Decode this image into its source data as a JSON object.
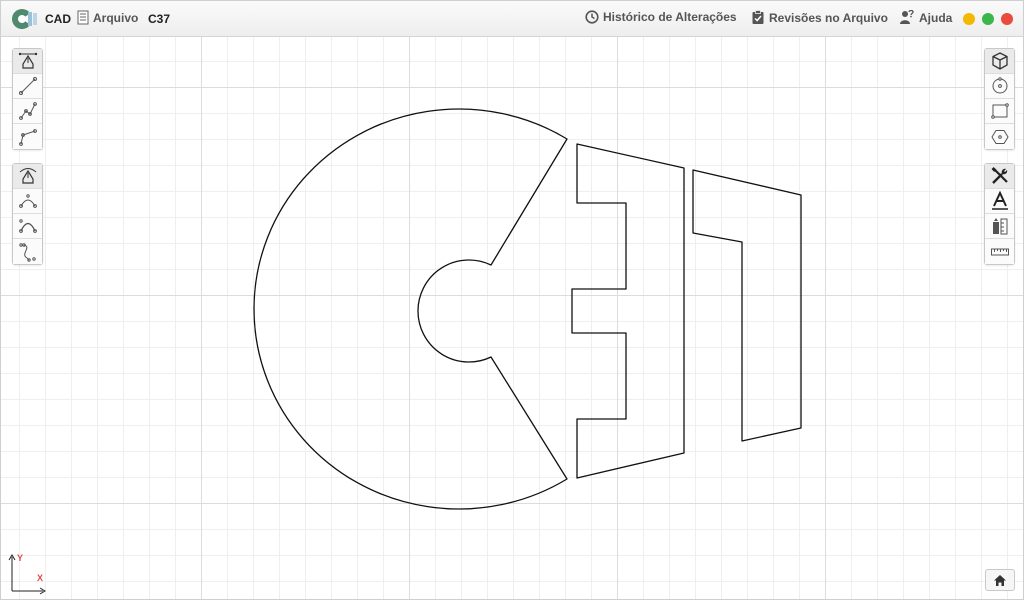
{
  "header": {
    "app_name": "CAD",
    "file_menu_label": "Arquivo",
    "document_name": "C37",
    "history_label": "Histórico de Alterações",
    "revisions_label": "Revisões no Arquivo",
    "help_label": "Ajuda"
  },
  "window_controls": {
    "minimize_color": "#f5b800",
    "maximize_color": "#3cb54a",
    "close_color": "#e94b3c"
  },
  "left_toolbar_1": [
    "draw-tool-icon",
    "line-icon",
    "polyline-icon",
    "curve-line-icon"
  ],
  "left_toolbar_2": [
    "bezier-tool-icon",
    "arc-icon",
    "arc-3point-icon",
    "spline-icon"
  ],
  "right_toolbar_1": [
    "box-3d-icon",
    "circle-icon",
    "rectangle-icon",
    "hexagon-icon"
  ],
  "right_toolbar_2": [
    "tools-icon",
    "text-icon",
    "dimensions-icon",
    "ruler-icon"
  ],
  "axis": {
    "y_label": "Y",
    "x_label": "X"
  },
  "colors": {
    "accent": "#333333",
    "axis": "#e04848",
    "stroke": "#111111"
  }
}
